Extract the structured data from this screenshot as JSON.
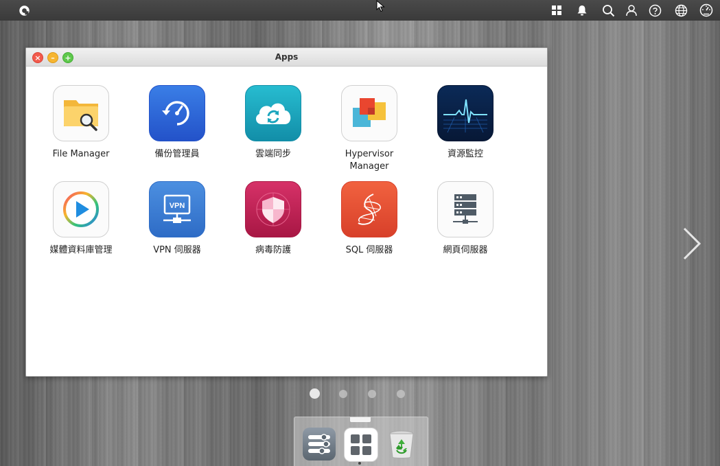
{
  "window": {
    "title": "Apps"
  },
  "apps": [
    {
      "label": "File Manager",
      "icon": "file-manager-icon"
    },
    {
      "label": "備份管理員",
      "icon": "backup-manager-icon"
    },
    {
      "label": "雲端同步",
      "icon": "cloud-sync-icon"
    },
    {
      "label": "Hypervisor Manager",
      "icon": "hypervisor-icon"
    },
    {
      "label": "資源監控",
      "icon": "resource-monitor-icon"
    },
    {
      "label": "媒體資料庫管理",
      "icon": "media-library-icon"
    },
    {
      "label": "VPN 伺服器",
      "icon": "vpn-server-icon"
    },
    {
      "label": "病毒防護",
      "icon": "antivirus-icon"
    },
    {
      "label": "SQL 伺服器",
      "icon": "sql-server-icon"
    },
    {
      "label": "網頁伺服器",
      "icon": "web-server-icon"
    }
  ],
  "vpn_badge": "VPN",
  "pagination": {
    "pages": 4,
    "current": 1
  },
  "colors": {
    "close": "#f25a4c",
    "minimize": "#f6b530",
    "maximize": "#5ec84b",
    "topbar": "#3f3f3f"
  },
  "topbar_icons": [
    "apps-grid-icon",
    "notification-bell-icon",
    "search-icon",
    "user-icon",
    "help-icon",
    "language-globe-icon",
    "dashboard-gauge-icon"
  ],
  "dock_items": [
    "control-panel-icon",
    "apps-icon",
    "recycle-bin-icon"
  ]
}
